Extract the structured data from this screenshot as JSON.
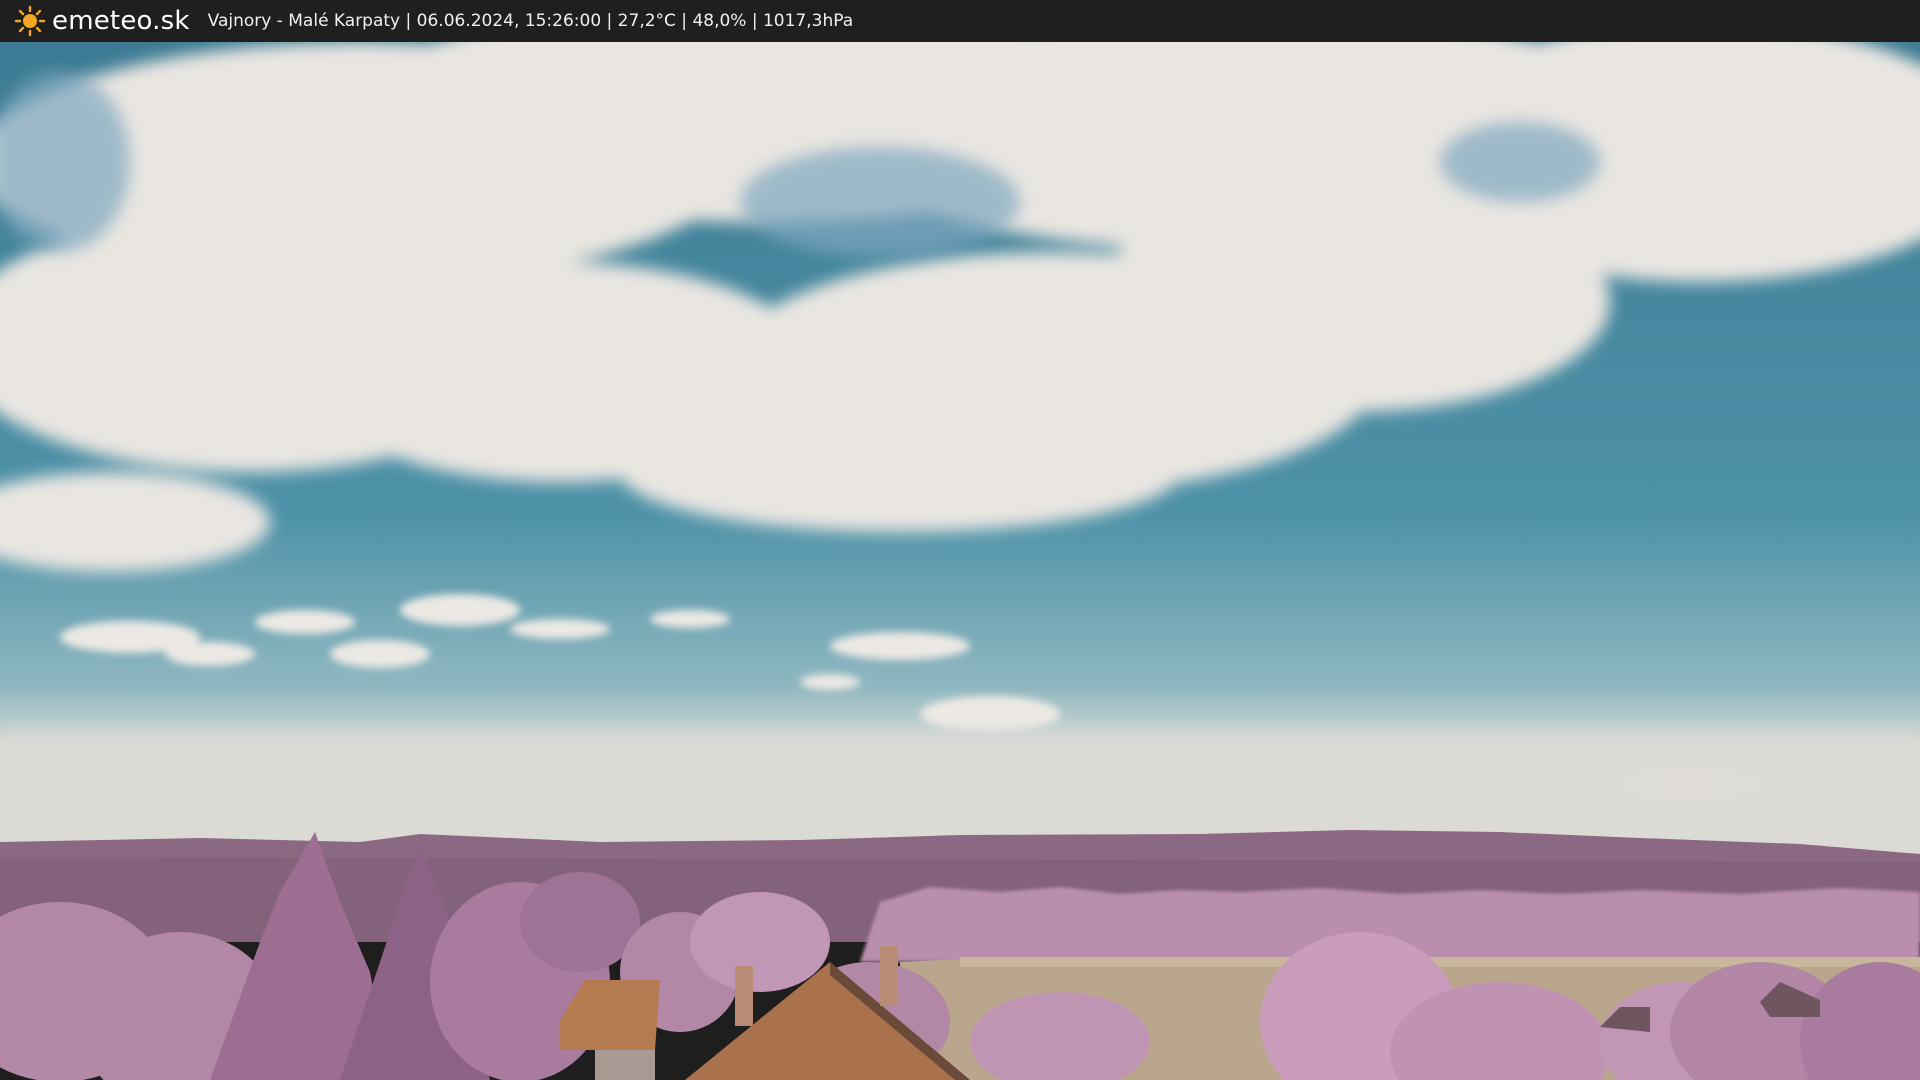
{
  "header": {
    "brand": "emeteo.sk",
    "caption": "Vajnory - Malé Karpaty | 06.06.2024, 15:26:00 | 27,2°C | 48,0% | 1017,3hPa"
  },
  "icons": {
    "logo": "sun-icon"
  },
  "colors": {
    "bar_bg": "#1f1f1f",
    "sun": "#f5a623",
    "sky_top": "#3f7f96",
    "sky_low": "#5f9db0",
    "cloud": "#eae7e2",
    "hills": "#8e6a85",
    "trees": "#b58aa8",
    "field": "#b8a58c",
    "roof": "#b07a55"
  }
}
